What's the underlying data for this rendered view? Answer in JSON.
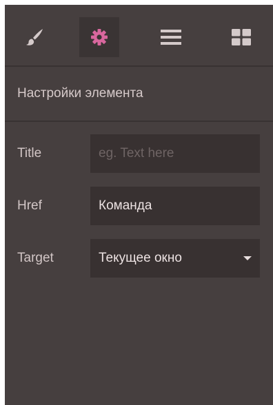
{
  "toolbar": {
    "buttons": [
      {
        "icon": "paint-brush-icon",
        "active": false
      },
      {
        "icon": "gear-icon",
        "active": true,
        "color": "#d9679e"
      },
      {
        "icon": "menu-lines-icon",
        "active": false
      },
      {
        "icon": "grid-blocks-icon",
        "active": false
      }
    ]
  },
  "section": {
    "title": "Настройки элемента"
  },
  "form": {
    "title_label": "Title",
    "title_placeholder": "eg. Text here",
    "title_value": "",
    "href_label": "Href",
    "href_value": "Команда",
    "target_label": "Target",
    "target_value": "Текущее окно"
  },
  "colors": {
    "panel_bg": "#463f3f",
    "field_bg": "#383131",
    "accent": "#d9679e",
    "icon": "#d4caca"
  }
}
